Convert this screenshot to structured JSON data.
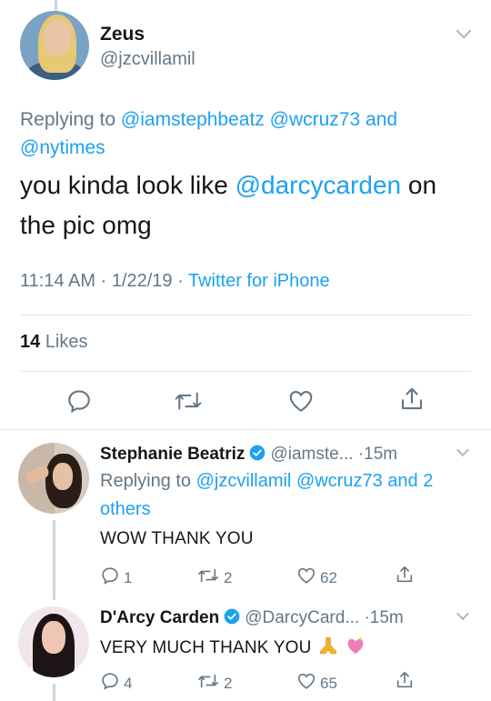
{
  "tweet": {
    "author_name": "Zeus",
    "author_handle": "@jzcvillamil",
    "replying_prefix": "Replying to",
    "replying_to_1": "@iamstephbeatz",
    "replying_to_2": "@wcruz73",
    "replying_joiner": "and",
    "replying_to_3": "@nytimes",
    "text_before": "you kinda look like",
    "mention": "@darcycarden",
    "text_after_1": "on",
    "text_after_2": "the pic omg",
    "time": "11:14 AM",
    "date": "1/22/19",
    "source": "Twitter for iPhone",
    "likes_count": "14",
    "likes_label": "Likes"
  },
  "replies": [
    {
      "name": "Stephanie Beatriz",
      "handle": "@iamste...",
      "age": "15m",
      "replying_prefix": "Replying to",
      "replying_to_1": "@jzcvillamil",
      "replying_to_2": "@wcruz73",
      "replying_rest": "and 2 others",
      "text": "WOW THANK YOU",
      "reply_count": "1",
      "retweet_count": "2",
      "like_count": "62"
    },
    {
      "name": "D'Arcy Carden",
      "handle": "@DarcyCard...",
      "age": "15m",
      "text": "VERY MUCH THANK YOU",
      "reply_count": "4",
      "retweet_count": "2",
      "like_count": "65"
    }
  ],
  "icons": {
    "reply": "reply-icon",
    "retweet": "retweet-icon",
    "like": "heart-icon",
    "share": "share-icon",
    "verified": "verified-badge-icon",
    "more": "chevron-down-icon",
    "emoji_1": "folded-hands-emoji",
    "emoji_2": "sparkling-heart-emoji"
  },
  "colors": {
    "accent": "#1da1f2",
    "secondary_text": "#657786",
    "divider": "#e1e8ed"
  }
}
